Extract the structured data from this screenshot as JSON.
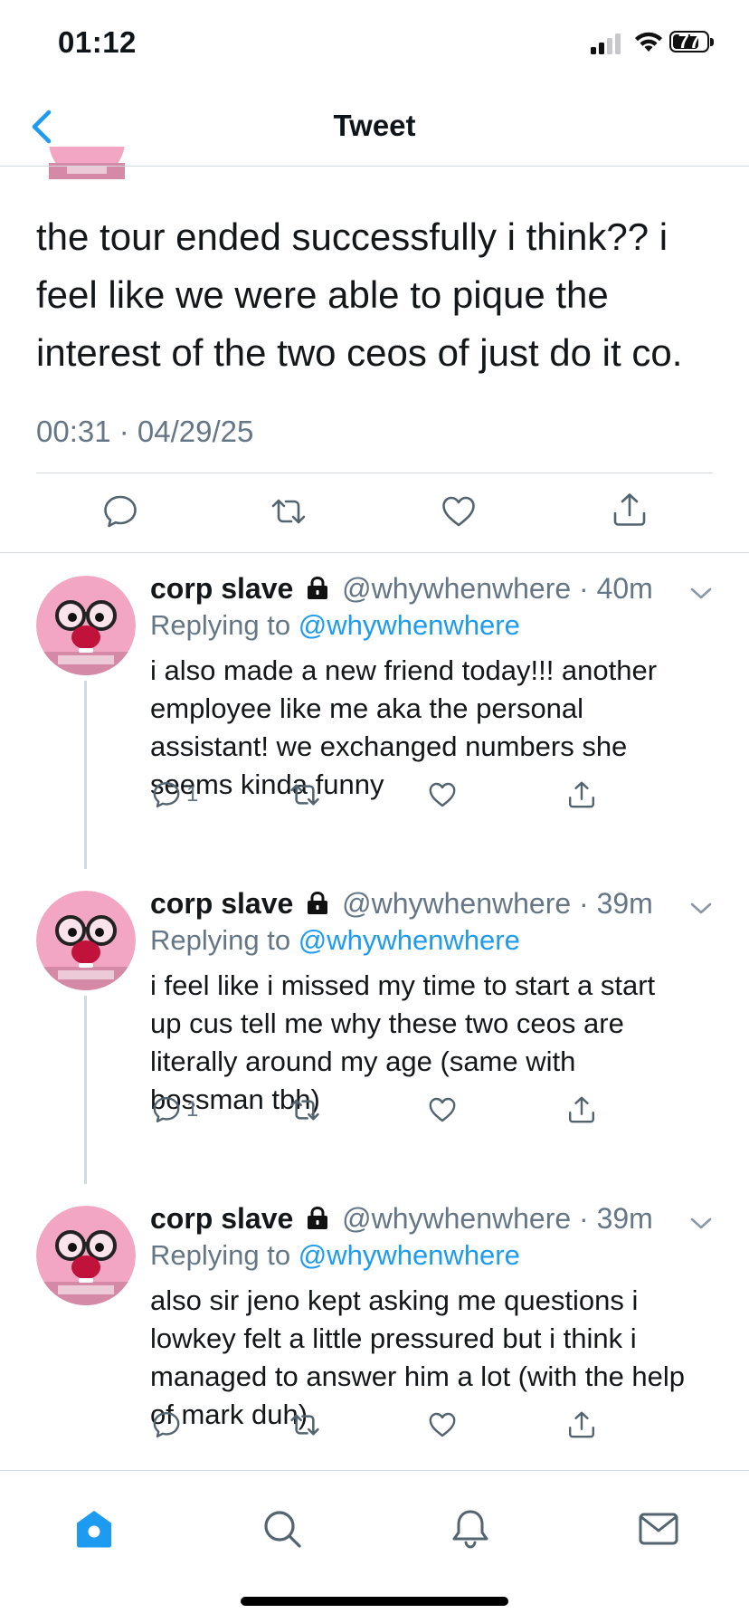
{
  "status_bar": {
    "time": "01:12",
    "battery": "77",
    "battery_level": 0.77
  },
  "header": {
    "title": "Tweet"
  },
  "tweet": {
    "text": "the tour ended successfully i think?? i feel like we were able to pique the interest of the two ceos of just do it co.",
    "meta": "00:31 · 04/29/25"
  },
  "replies": [
    {
      "name": "corp slave",
      "handle": "@whywhenwhere",
      "time": "40m",
      "replying_label": "Replying to",
      "replying_to": "@whywhenwhere",
      "text": "i also made a new friend today!!! another employee like me aka the personal assistant! we exchanged numbers she seems kinda funny",
      "reply_count": "1"
    },
    {
      "name": "corp slave",
      "handle": "@whywhenwhere",
      "time": "39m",
      "replying_label": "Replying to",
      "replying_to": "@whywhenwhere",
      "text": "i feel like i missed my time to start a start up cus tell me why these two ceos are literally around my age (same with bossman tbh)",
      "reply_count": "1"
    },
    {
      "name": "corp slave",
      "handle": "@whywhenwhere",
      "time": "39m",
      "replying_label": "Replying to",
      "replying_to": "@whywhenwhere",
      "text": "also sir jeno kept asking me questions i lowkey felt a little pressured but i think i managed to answer him a lot (with the help of mark duh)",
      "reply_count": ""
    }
  ],
  "icons": {
    "back": "chevron-left-icon",
    "reply": "comment-icon",
    "retweet": "retweet-icon",
    "like": "heart-icon",
    "share": "share-icon",
    "tabs": [
      "home-icon",
      "search-icon",
      "bell-icon",
      "mail-icon"
    ]
  },
  "colors": {
    "accent": "#1d9bf0",
    "muted": "#657786",
    "divider": "#cfd9de",
    "avatar_pink": "#f3a6c3"
  }
}
